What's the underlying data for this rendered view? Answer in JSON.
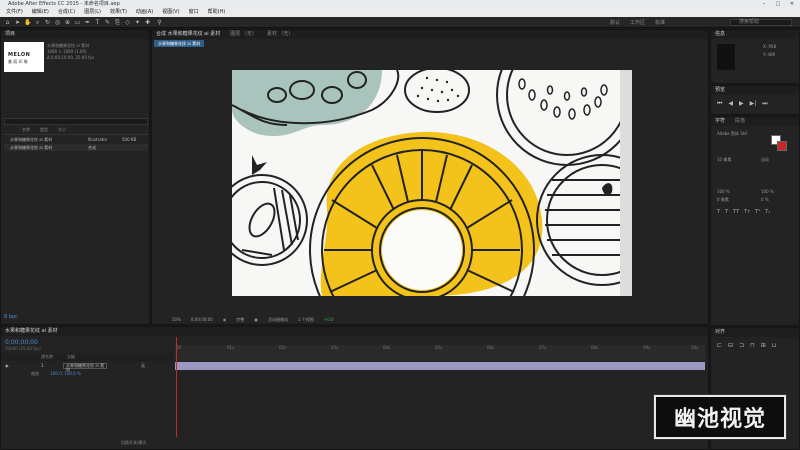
{
  "window": {
    "title": "Adobe After Effects CC 2015 - 未命名项目.aep"
  },
  "menu": [
    "文件(F)",
    "编辑(E)",
    "合成(C)",
    "图层(L)",
    "效果(T)",
    "动画(A)",
    "视图(V)",
    "窗口",
    "帮助(H)"
  ],
  "toolbar": {
    "workspaces": [
      "默认",
      "工作区",
      "标准"
    ],
    "search_placeholder": "搜索帮助"
  },
  "project": {
    "tab": "项目",
    "thumb_brand": "MELON",
    "thumb_sub": "美 丽 印 象",
    "item_name": "水果和糖果花纹 ai 素材",
    "info": [
      "1080 × 1080 (1.00)",
      "Δ 0:00:10:00, 25.00 fps"
    ],
    "columns": [
      "名称",
      "类型",
      "大小"
    ],
    "rows": [
      {
        "name": "水果和糖果花纹 ai 素材",
        "type": "Illustrator",
        "size": "500 KB"
      },
      {
        "name": "水果和糖果花纹 ai 素材",
        "type": "合成"
      }
    ],
    "bpc": "8 bpc"
  },
  "composition": {
    "tabs": [
      "合成 水果和糖果花纹 ai 素材",
      "图层 （无）",
      "素材 （无）"
    ],
    "active_tab": "水果和糖果花纹 ai 素材",
    "zoom": "50%",
    "timecode": "0;00;00;00",
    "quality": "完整",
    "camera": "活动摄像机",
    "views": "1 个视图",
    "exposure": "+0.0"
  },
  "info_panel": {
    "tab": "信息",
    "x": "X: 958",
    "y": "Y: 489"
  },
  "preview_panel": {
    "tab": "预览"
  },
  "character_panel": {
    "tabs": [
      "字符",
      "段落"
    ],
    "font": "Adobe 黑体 Std",
    "size_a": "10 像素",
    "size_b": "自动",
    "scale_a": "100 %",
    "scale_b": "100 %",
    "baseline": "0 像素",
    "tsume": "0 %"
  },
  "align_panel": {
    "tab": "对齐"
  },
  "timeline": {
    "tab": "水果和糖果花纹 ai 素材",
    "timecode": "0;00;00;00",
    "fps": "00000 (25.00 fps)",
    "columns": [
      "源名称",
      "父级"
    ],
    "layer_index": "1",
    "layer_name": "水果和糖果花纹 ai 素材",
    "parent": "无",
    "transform_label": "缩放",
    "transform_value": "100.0, 100.0 %",
    "ticks": [
      "0f",
      "01s",
      "02s",
      "03s",
      "04s",
      "05s",
      "06s",
      "07s",
      "08s",
      "09s",
      "10s"
    ],
    "bottom_toggle": "切换开关/模式"
  },
  "watermark": "幽池视觉"
}
